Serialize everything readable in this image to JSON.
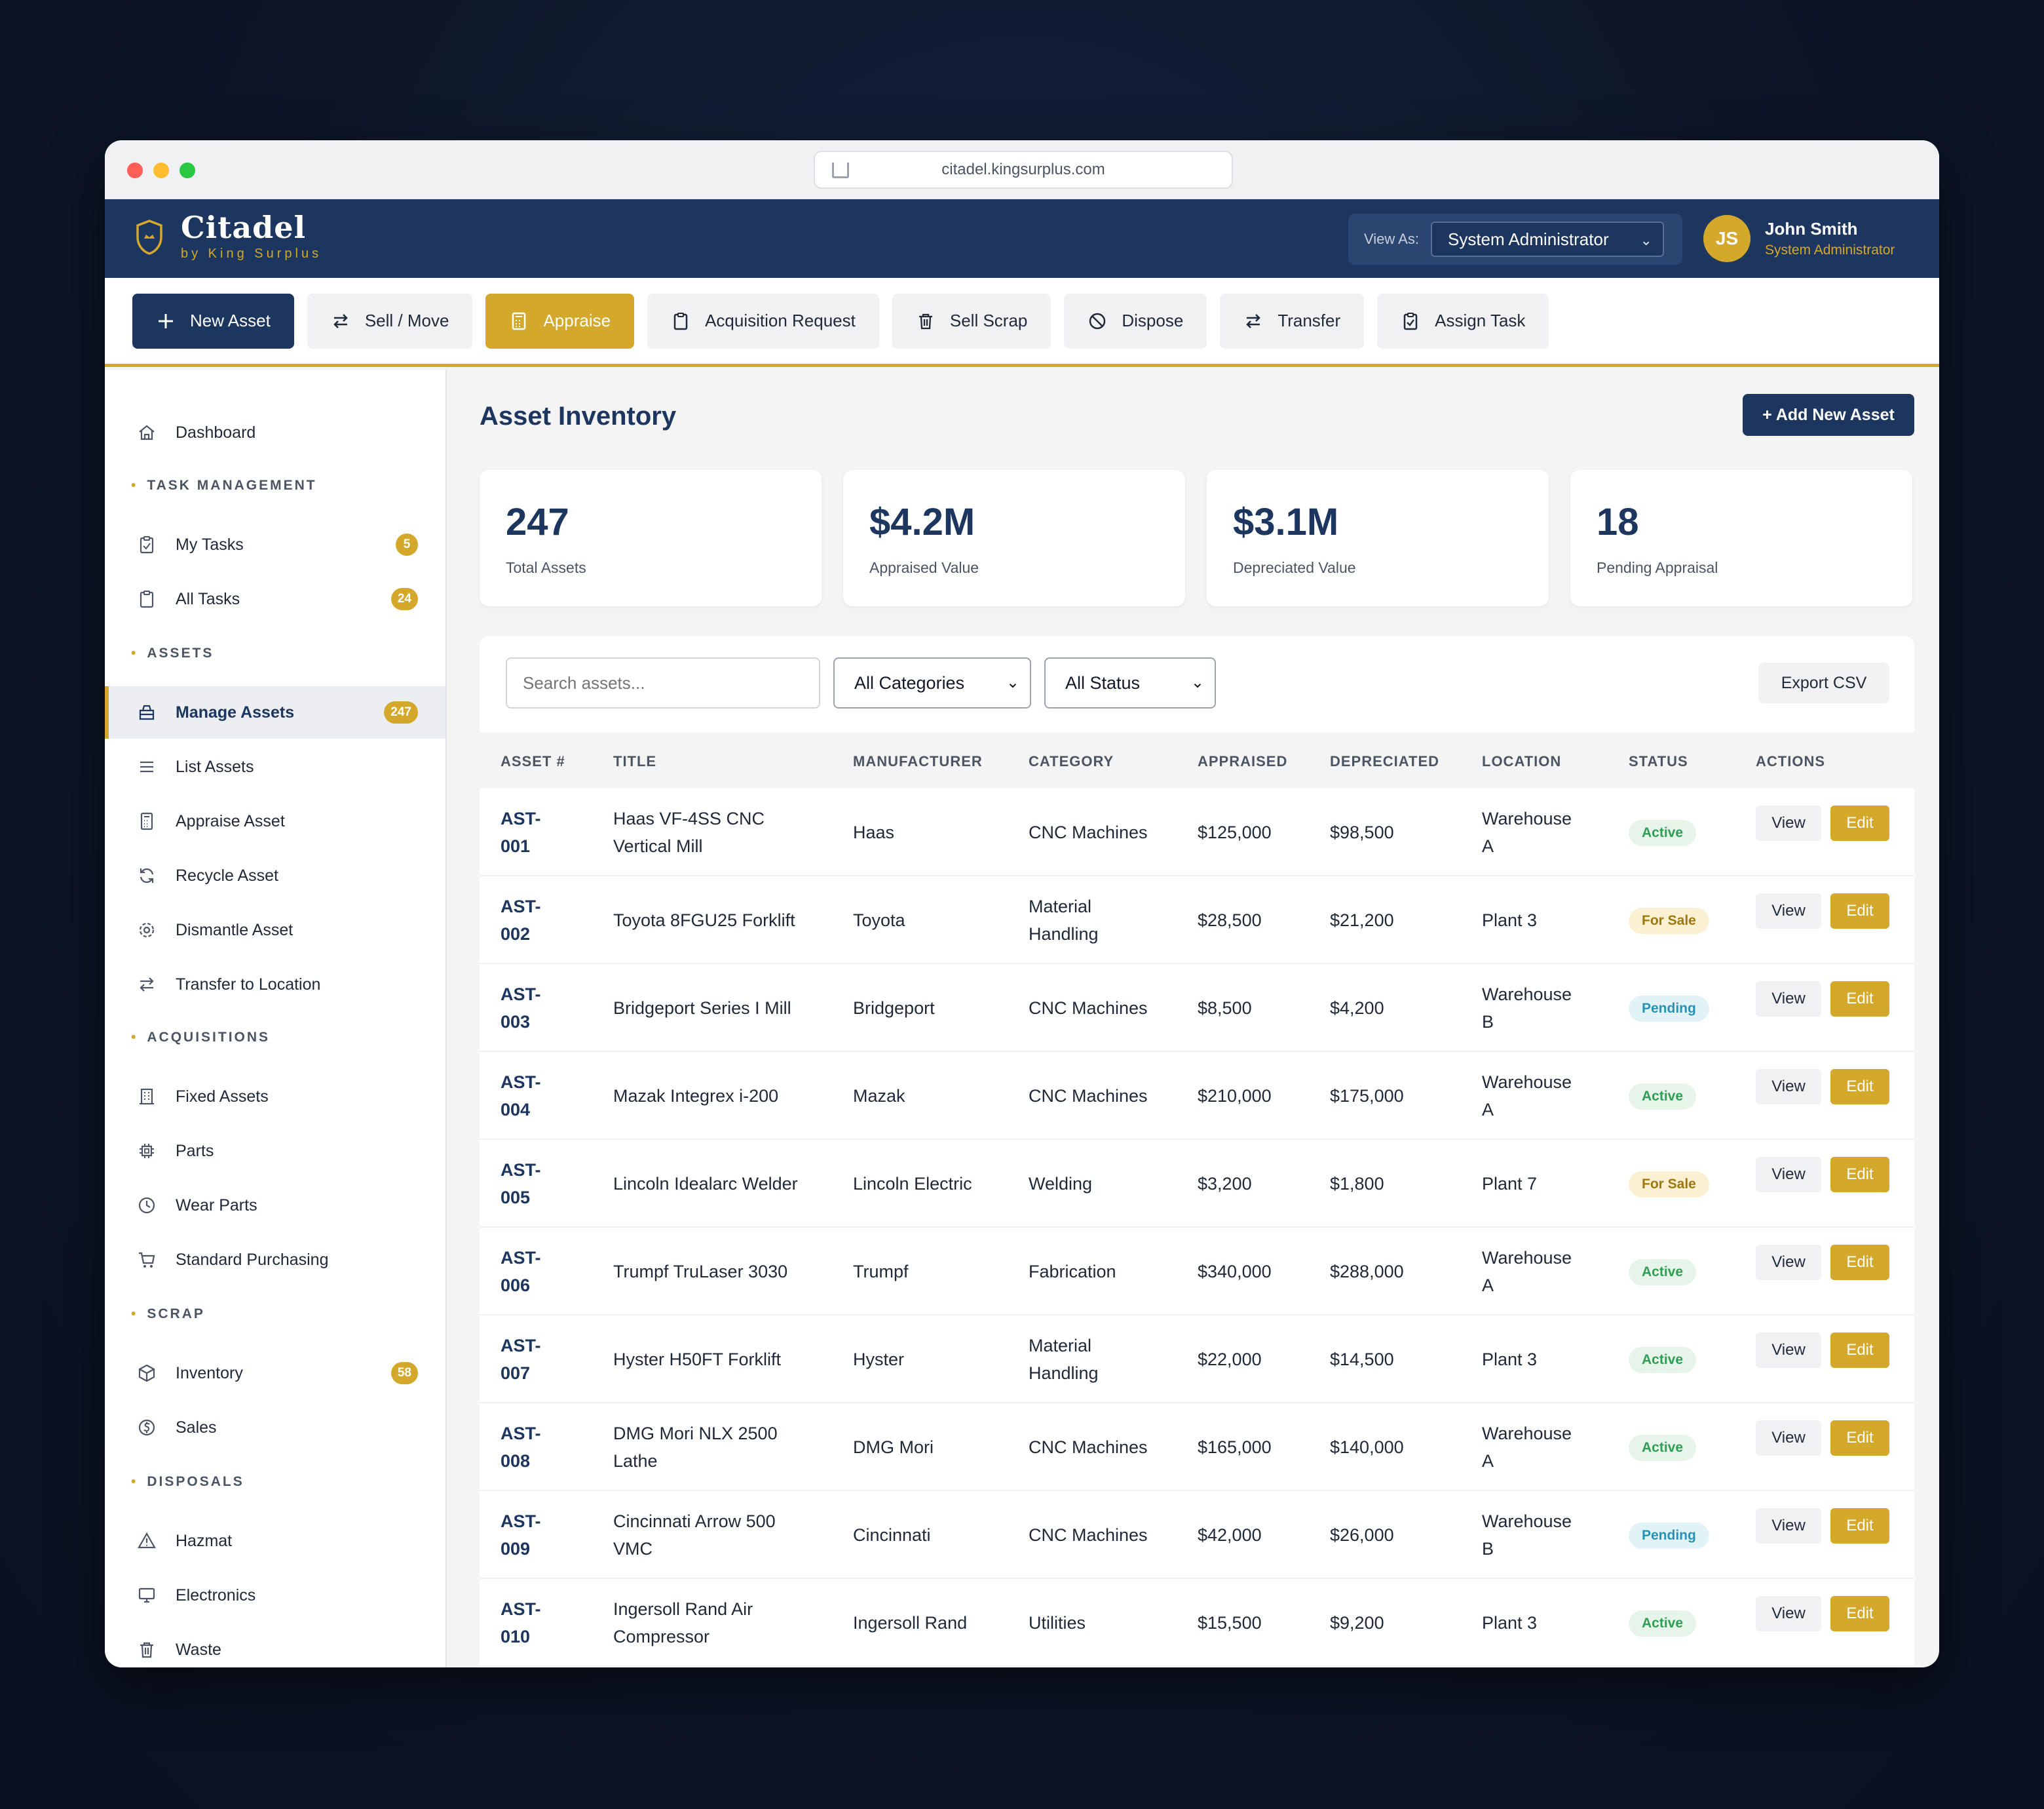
{
  "browser": {
    "url": "citadel.kingsurplus.com"
  },
  "app": {
    "name": "Citadel",
    "subtitle": "by King Surplus",
    "view_as_label": "View As:",
    "view_as_value": "System Administrator",
    "user": {
      "initials": "JS",
      "name": "John Smith",
      "role": "System Administrator"
    }
  },
  "toolbar": [
    {
      "label": "New Asset",
      "icon": "plus-icon"
    },
    {
      "label": "Sell / Move",
      "icon": "swap-icon"
    },
    {
      "label": "Appraise",
      "icon": "calculator-icon"
    },
    {
      "label": "Acquisition Request",
      "icon": "clipboard-icon"
    },
    {
      "label": "Sell Scrap",
      "icon": "trash-icon"
    },
    {
      "label": "Dispose",
      "icon": "ban-icon"
    },
    {
      "label": "Transfer",
      "icon": "swap-icon"
    },
    {
      "label": "Assign Task",
      "icon": "clipboard-check-icon"
    }
  ],
  "sidebar": {
    "dashboard": "Dashboard",
    "sections": {
      "task_management": "TASK MANAGEMENT",
      "assets": "ASSETS",
      "acquisitions": "ACQUISITIONS",
      "scrap": "SCRAP",
      "disposals": "DISPOSALS"
    },
    "items": {
      "my_tasks": {
        "label": "My Tasks",
        "count": "5"
      },
      "all_tasks": {
        "label": "All Tasks",
        "count": "24"
      },
      "manage_assets": {
        "label": "Manage Assets",
        "count": "247"
      },
      "list_assets": {
        "label": "List Assets"
      },
      "appraise_asset": {
        "label": "Appraise Asset"
      },
      "recycle_asset": {
        "label": "Recycle Asset"
      },
      "dismantle_asset": {
        "label": "Dismantle Asset"
      },
      "transfer_location": {
        "label": "Transfer to Location"
      },
      "fixed_assets": {
        "label": "Fixed Assets"
      },
      "parts": {
        "label": "Parts"
      },
      "wear_parts": {
        "label": "Wear Parts"
      },
      "standard_purchasing": {
        "label": "Standard Purchasing"
      },
      "inventory": {
        "label": "Inventory",
        "count": "58"
      },
      "sales": {
        "label": "Sales"
      },
      "hazmat": {
        "label": "Hazmat"
      },
      "electronics": {
        "label": "Electronics"
      },
      "waste": {
        "label": "Waste"
      }
    }
  },
  "main": {
    "title": "Asset Inventory",
    "add_button": "+ Add New Asset",
    "stats": [
      {
        "value": "247",
        "label": "Total Assets"
      },
      {
        "value": "$4.2M",
        "label": "Appraised Value"
      },
      {
        "value": "$3.1M",
        "label": "Depreciated Value"
      },
      {
        "value": "18",
        "label": "Pending Appraisal"
      }
    ],
    "search_placeholder": "Search assets...",
    "category_filter": "All Categories",
    "status_filter": "All Status",
    "export_label": "Export CSV",
    "columns": [
      "ASSET #",
      "TITLE",
      "MANUFACTURER",
      "CATEGORY",
      "APPRAISED",
      "DEPRECIATED",
      "LOCATION",
      "STATUS",
      "ACTIONS"
    ],
    "view_label": "View",
    "edit_label": "Edit",
    "rows": [
      {
        "id1": "AST-",
        "id2": "001",
        "title1": "Haas VF-4SS CNC",
        "title2": "Vertical Mill",
        "manufacturer": "Haas",
        "cat1": "CNC Machines",
        "cat2": "",
        "appraised": "$125,000",
        "depreciated": "$98,500",
        "loc1": "Warehouse",
        "loc2": "A",
        "status": "Active"
      },
      {
        "id1": "AST-",
        "id2": "002",
        "title1": "Toyota 8FGU25 Forklift",
        "title2": "",
        "manufacturer": "Toyota",
        "cat1": "Material",
        "cat2": "Handling",
        "appraised": "$28,500",
        "depreciated": "$21,200",
        "loc1": "Plant 3",
        "loc2": "",
        "status": "For Sale"
      },
      {
        "id1": "AST-",
        "id2": "003",
        "title1": "Bridgeport Series I Mill",
        "title2": "",
        "manufacturer": "Bridgeport",
        "cat1": "CNC Machines",
        "cat2": "",
        "appraised": "$8,500",
        "depreciated": "$4,200",
        "loc1": "Warehouse",
        "loc2": "B",
        "status": "Pending"
      },
      {
        "id1": "AST-",
        "id2": "004",
        "title1": "Mazak Integrex i-200",
        "title2": "",
        "manufacturer": "Mazak",
        "cat1": "CNC Machines",
        "cat2": "",
        "appraised": "$210,000",
        "depreciated": "$175,000",
        "loc1": "Warehouse",
        "loc2": "A",
        "status": "Active"
      },
      {
        "id1": "AST-",
        "id2": "005",
        "title1": "Lincoln Idealarc Welder",
        "title2": "",
        "manufacturer": "Lincoln Electric",
        "cat1": "Welding",
        "cat2": "",
        "appraised": "$3,200",
        "depreciated": "$1,800",
        "loc1": "Plant 7",
        "loc2": "",
        "status": "For Sale"
      },
      {
        "id1": "AST-",
        "id2": "006",
        "title1": "Trumpf TruLaser 3030",
        "title2": "",
        "manufacturer": "Trumpf",
        "cat1": "Fabrication",
        "cat2": "",
        "appraised": "$340,000",
        "depreciated": "$288,000",
        "loc1": "Warehouse",
        "loc2": "A",
        "status": "Active"
      },
      {
        "id1": "AST-",
        "id2": "007",
        "title1": "Hyster H50FT Forklift",
        "title2": "",
        "manufacturer": "Hyster",
        "cat1": "Material",
        "cat2": "Handling",
        "appraised": "$22,000",
        "depreciated": "$14,500",
        "loc1": "Plant 3",
        "loc2": "",
        "status": "Active"
      },
      {
        "id1": "AST-",
        "id2": "008",
        "title1": "DMG Mori NLX 2500",
        "title2": "Lathe",
        "manufacturer": "DMG Mori",
        "cat1": "CNC Machines",
        "cat2": "",
        "appraised": "$165,000",
        "depreciated": "$140,000",
        "loc1": "Warehouse",
        "loc2": "A",
        "status": "Active"
      },
      {
        "id1": "AST-",
        "id2": "009",
        "title1": "Cincinnati Arrow 500",
        "title2": "VMC",
        "manufacturer": "Cincinnati",
        "cat1": "CNC Machines",
        "cat2": "",
        "appraised": "$42,000",
        "depreciated": "$26,000",
        "loc1": "Warehouse",
        "loc2": "B",
        "status": "Pending"
      },
      {
        "id1": "AST-",
        "id2": "010",
        "title1": "Ingersoll Rand Air",
        "title2": "Compressor",
        "manufacturer": "Ingersoll Rand",
        "cat1": "Utilities",
        "cat2": "",
        "appraised": "$15,500",
        "depreciated": "$9,200",
        "loc1": "Plant 3",
        "loc2": "",
        "status": "Active"
      }
    ]
  },
  "colors": {
    "navy": "#1c3660",
    "gold": "#d4a82a",
    "active": "#2f9e55",
    "for_sale": "#a0770f",
    "pending": "#2593b5"
  }
}
